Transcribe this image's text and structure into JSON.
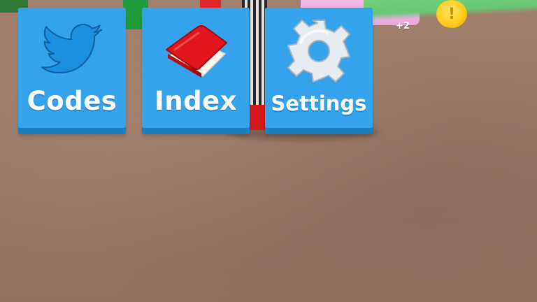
{
  "hud": {
    "coin_symbol": "!",
    "coin_gain_text": "+2"
  },
  "menu": {
    "buttons": [
      {
        "id": "codes",
        "label": "Codes",
        "icon": "twitter-bird-icon"
      },
      {
        "id": "index",
        "label": "Index",
        "icon": "red-book-icon"
      },
      {
        "id": "settings",
        "label": "Settings",
        "icon": "gear-icon"
      }
    ]
  },
  "colors": {
    "button_blue": "#34a3ec",
    "button_shadow": "#1c7ec0",
    "ground": "#9c7c6a",
    "book_red": "#e2141c",
    "twitter_blue": "#1d8fe0",
    "gear_silver": "#e6ebf0",
    "coin_gold": "#ffcd1e"
  }
}
